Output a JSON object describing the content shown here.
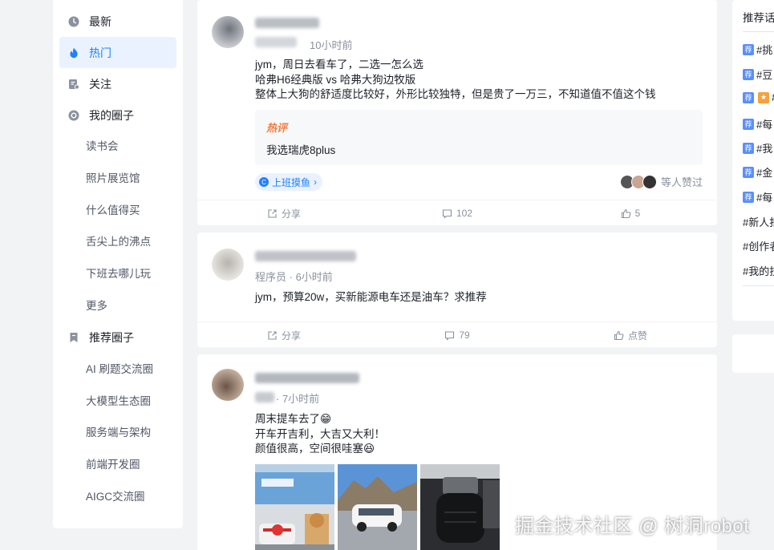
{
  "sidebar": {
    "latest": "最新",
    "hot": "热门",
    "follow": "关注",
    "my_circles": "我的圈子",
    "my_circle_items": [
      "读书会",
      "照片展览馆",
      "什么值得买",
      "舌尖上的沸点",
      "下班去哪儿玩",
      "更多"
    ],
    "recommended_circles": "推荐圈子",
    "recommended_items": [
      "AI 刷题交流圈",
      "大模型生态圈",
      "服务端与架构",
      "前端开发圈",
      "AIGC交流圈"
    ]
  },
  "posts": [
    {
      "time": "10小时前",
      "lines": [
        "jym，周日去看车了，二选一怎么选",
        "哈弗H6经典版 vs 哈弗大狗边牧版",
        "整体上大狗的舒适度比较好，外形比较独特，但是贵了一万三，不知道值不值这个钱"
      ],
      "hot_label": "热评",
      "hot_comment": "我选瑞虎8plus",
      "circle": "上班摸鱼",
      "likers_text": "等人赞过",
      "share": "分享",
      "comments": "102",
      "likes": "5"
    },
    {
      "role": "程序员",
      "time": "6小时前",
      "lines": [
        "jym，预算20w，买新能源电车还是油车？求推荐"
      ],
      "share": "分享",
      "comments": "79",
      "likes": "点赞"
    },
    {
      "time": "7小时前",
      "lines": [
        "周末提车去了😁",
        "开车开吉利，大吉又大利！",
        "颜值很高，空间很哇塞😆"
      ]
    }
  ],
  "right": {
    "title": "推荐话题",
    "badge": "荐",
    "topics": [
      "#挑",
      "#豆",
      "#",
      "#每",
      "#我",
      "#金",
      "#每"
    ],
    "plain_topics": [
      "#新人报",
      "#创作者",
      "#我的技"
    ]
  },
  "watermark": "掘金技术社区 @ 树洞robot",
  "colors": {
    "accent": "#1e80ff",
    "hot": "#f47b3e"
  }
}
